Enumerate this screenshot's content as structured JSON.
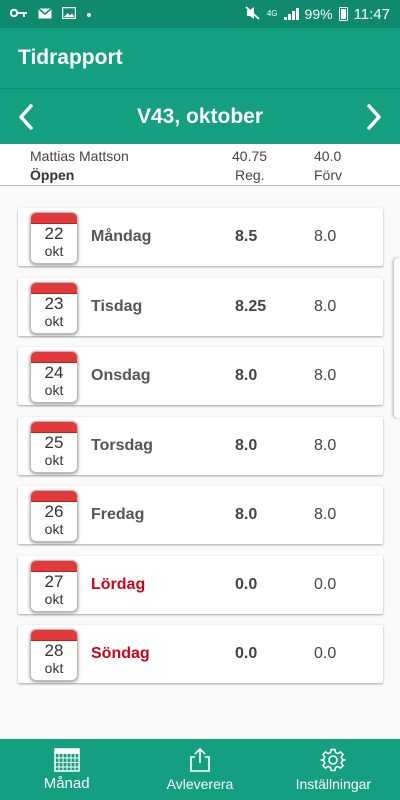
{
  "status_bar": {
    "battery": "99%",
    "time": "11:47",
    "network": "4G"
  },
  "app": {
    "title": "Tidrapport"
  },
  "week": {
    "title": "V43, oktober"
  },
  "summary": {
    "name": "Mattias Mattson",
    "status": "Öppen",
    "reg_value": "40.75",
    "reg_label": "Reg.",
    "forv_value": "40.0",
    "forv_label": "Förv"
  },
  "days": [
    {
      "date": "22",
      "month": "okt",
      "name": "Måndag",
      "reg": "8.5",
      "forv": "8.0",
      "weekend": false
    },
    {
      "date": "23",
      "month": "okt",
      "name": "Tisdag",
      "reg": "8.25",
      "forv": "8.0",
      "weekend": false
    },
    {
      "date": "24",
      "month": "okt",
      "name": "Onsdag",
      "reg": "8.0",
      "forv": "8.0",
      "weekend": false
    },
    {
      "date": "25",
      "month": "okt",
      "name": "Torsdag",
      "reg": "8.0",
      "forv": "8.0",
      "weekend": false
    },
    {
      "date": "26",
      "month": "okt",
      "name": "Fredag",
      "reg": "8.0",
      "forv": "8.0",
      "weekend": false
    },
    {
      "date": "27",
      "month": "okt",
      "name": "Lördag",
      "reg": "0.0",
      "forv": "0.0",
      "weekend": true
    },
    {
      "date": "28",
      "month": "okt",
      "name": "Söndag",
      "reg": "0.0",
      "forv": "0.0",
      "weekend": true
    }
  ],
  "bottom_nav": {
    "items": [
      {
        "label": "Månad",
        "icon": "calendar-grid-icon"
      },
      {
        "label": "Avleverera",
        "icon": "share-upload-icon"
      },
      {
        "label": "Inställningar",
        "icon": "gear-icon"
      }
    ]
  },
  "colors": {
    "primary": "#14a080",
    "status_bar": "#0f8a6f",
    "weekend": "#d0021b",
    "calendar_red": "#e23a3a"
  }
}
